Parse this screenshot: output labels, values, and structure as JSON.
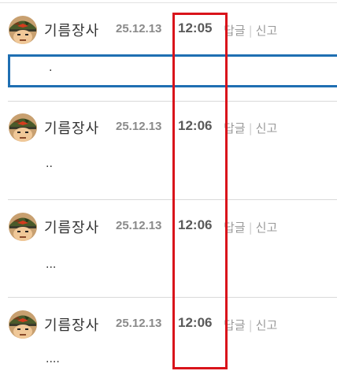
{
  "comments": [
    {
      "nickname": "기름장사",
      "date": "25.12.13",
      "time": "12:05",
      "reply": "답글",
      "separator": "|",
      "report": "신고",
      "text": "."
    },
    {
      "nickname": "기름장사",
      "date": "25.12.13",
      "time": "12:06",
      "reply": "답글",
      "separator": "|",
      "report": "신고",
      "text": ".."
    },
    {
      "nickname": "기름장사",
      "date": "25.12.13",
      "time": "12:06",
      "reply": "답글",
      "separator": "|",
      "report": "신고",
      "text": "..."
    },
    {
      "nickname": "기름장사",
      "date": "25.12.13",
      "time": "12:06",
      "reply": "답글",
      "separator": "|",
      "report": "신고",
      "text": "...."
    }
  ],
  "colors": {
    "selection_border": "#1f6fb2",
    "highlight_border": "#d9141b"
  },
  "icons": {
    "avatar": "soldier-avatar-icon"
  }
}
